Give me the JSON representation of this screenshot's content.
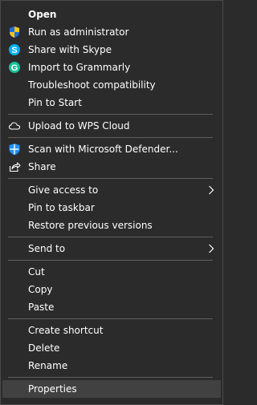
{
  "colors": {
    "background": "#2b2b2b",
    "text": "#ffffff",
    "separator": "#5f5f5f",
    "hover": "#414141",
    "skype": "#00aff0",
    "grammarly": "#15c39a",
    "defender": "#1e90ff"
  },
  "menu": {
    "open": "Open",
    "run_as_admin": "Run as administrator",
    "share_skype": "Share with Skype",
    "import_grammarly": "Import to Grammarly",
    "troubleshoot": "Troubleshoot compatibility",
    "pin_start": "Pin to Start",
    "upload_wps": "Upload to WPS Cloud",
    "scan_defender": "Scan with Microsoft Defender...",
    "share": "Share",
    "give_access": "Give access to",
    "pin_taskbar": "Pin to taskbar",
    "restore_versions": "Restore previous versions",
    "send_to": "Send to",
    "cut": "Cut",
    "copy": "Copy",
    "paste": "Paste",
    "create_shortcut": "Create shortcut",
    "delete": "Delete",
    "rename": "Rename",
    "properties": "Properties"
  },
  "icons": {
    "run_as_admin": "uac-shield-icon",
    "share_skype": "skype-icon",
    "import_grammarly": "grammarly-icon",
    "upload_wps": "cloud-icon",
    "scan_defender": "defender-shield-icon",
    "share": "share-icon",
    "submenu": "chevron-right-icon"
  }
}
